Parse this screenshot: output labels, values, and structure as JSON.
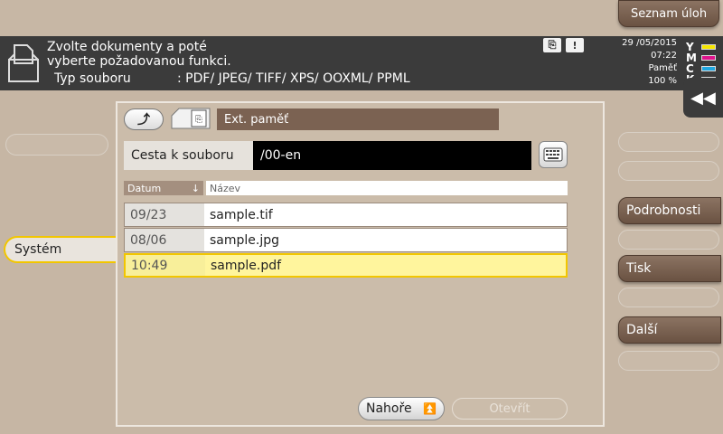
{
  "task_list_button": "Seznam úloh",
  "header": {
    "message_line1": "Zvolte dokumenty a poté",
    "message_line2": "vyberte požadovanou funkci.",
    "file_type_label": "Typ souboru",
    "file_type_value": ": PDF/ JPEG/ TIFF/ XPS/ OOXML/ PPML",
    "date": "29 /05/2015",
    "time": "07:22",
    "memory_label": "Paměť",
    "memory_value": "100 %",
    "toner": [
      {
        "letter": "Y",
        "color": "#f5e600"
      },
      {
        "letter": "M",
        "color": "#e0148c"
      },
      {
        "letter": "C",
        "color": "#1fa6e0"
      },
      {
        "letter": "K",
        "color": "#222222"
      }
    ]
  },
  "left_panel": {
    "system_tab": "Systém"
  },
  "location": {
    "label": "Ext. paměť"
  },
  "path": {
    "label": "Cesta k souboru",
    "value": "/00-en"
  },
  "columns": {
    "date": "Datum",
    "name": "Název"
  },
  "files": [
    {
      "date": "09/23",
      "name": "sample.tif"
    },
    {
      "date": "08/06",
      "name": "sample.jpg"
    },
    {
      "date": "10:49",
      "name": "sample.pdf"
    }
  ],
  "footer": {
    "top_button": "Nahoře",
    "open_button": "Otevřít"
  },
  "right_panel": {
    "details": "Podrobnosti",
    "print": "Tisk",
    "more": "Další"
  }
}
